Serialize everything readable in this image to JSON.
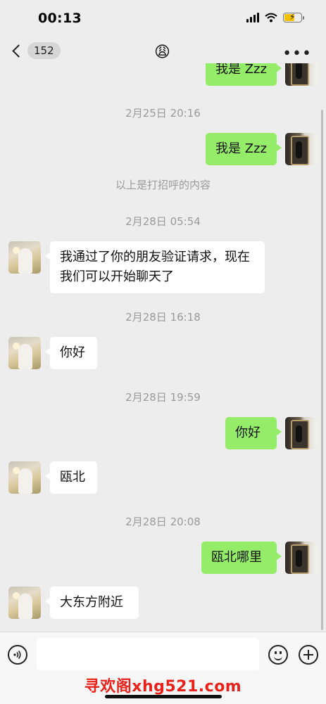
{
  "status": {
    "time": "00:13"
  },
  "nav": {
    "back_count": "152",
    "title_emoji": "😩",
    "more": "•••"
  },
  "messages": {
    "m0": "我是 Zzz",
    "ts1": "2月25日 20:16",
    "m1": "我是 Zzz",
    "sys": "以上是打招呼的内容",
    "ts2": "2月28日 05:54",
    "m2": "我通过了你的朋友验证请求，现在我们可以开始聊天了",
    "ts3": "2月28日 16:18",
    "m3": "你好",
    "ts4": "2月28日 19:59",
    "m4": "你好",
    "m5": "瓯北",
    "ts5": "2月28日 20:08",
    "m6": "瓯北哪里",
    "m7": "大东方附近"
  },
  "input": {
    "placeholder": ""
  },
  "watermark": "寻欢阁xhg521.com",
  "colors": {
    "outgoing_bubble": "#95ec69",
    "incoming_bubble": "#ffffff",
    "background": "#ededed",
    "watermark": "#e8221b"
  }
}
